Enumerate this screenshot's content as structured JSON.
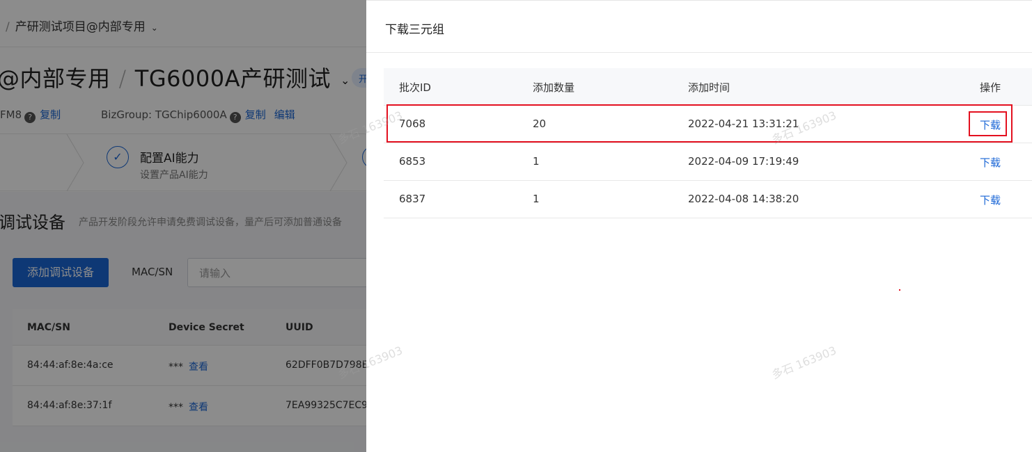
{
  "background": {
    "breadcrumb": {
      "separator": "/",
      "label": "产研测试项目@内部专用",
      "chevron": "⌄"
    },
    "title": {
      "part1": "@内部专用",
      "slash": "/",
      "part2": "TG6000A产研测试",
      "chevron": "⌄",
      "tag": "开"
    },
    "meta": {
      "pk_suffix": "FM8",
      "copy1": "复制",
      "bizgroup": "BizGroup: TGChip6000A",
      "copy2": "复制",
      "edit": "编辑"
    },
    "step": {
      "icon": "✓",
      "title": "配置AI能力",
      "subtitle": "设置产品AI能力"
    },
    "section": {
      "title": "调试设备",
      "description": "产品开发阶段允许申请免费调试设备，量产后可添加普通设备"
    },
    "toolbar": {
      "add_button": "添加调试设备",
      "mac_label": "MAC/SN",
      "mac_placeholder": "请输入"
    },
    "table": {
      "headers": [
        "MAC/SN",
        "Device Secret",
        "UUID"
      ],
      "rows": [
        {
          "mac": "84:44:af:8e:4a:ce",
          "secret": "***",
          "view": "查看",
          "uuid": "62DFF0B7D798E"
        },
        {
          "mac": "84:44:af:8e:37:1f",
          "secret": "***",
          "view": "查看",
          "uuid": "7EA99325C7EC9"
        }
      ]
    }
  },
  "drawer": {
    "title": "下载三元组",
    "headers": {
      "batch": "批次ID",
      "count": "添加数量",
      "time": "添加时间",
      "action": "操作"
    },
    "rows": [
      {
        "batch": "7068",
        "count": "20",
        "time": "2022-04-21 13:31:21",
        "action": "下载"
      },
      {
        "batch": "6853",
        "count": "1",
        "time": "2022-04-09 17:19:49",
        "action": "下载"
      },
      {
        "batch": "6837",
        "count": "1",
        "time": "2022-04-08 14:38:20",
        "action": "下载"
      }
    ]
  },
  "watermark": "多石 163903",
  "colors": {
    "primary": "#1a66d6",
    "highlight": "#e3101f",
    "overlay": "rgba(0,0,0,0.45)"
  }
}
